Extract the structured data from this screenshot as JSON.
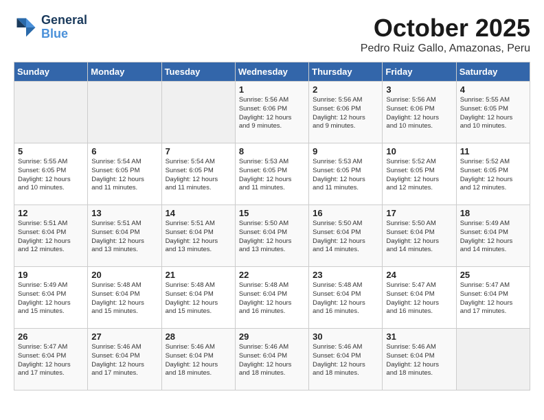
{
  "header": {
    "logo_line1": "General",
    "logo_line2": "Blue",
    "title": "October 2025",
    "subtitle": "Pedro Ruiz Gallo, Amazonas, Peru"
  },
  "days_of_week": [
    "Sunday",
    "Monday",
    "Tuesday",
    "Wednesday",
    "Thursday",
    "Friday",
    "Saturday"
  ],
  "weeks": [
    [
      {
        "day": "",
        "info": ""
      },
      {
        "day": "",
        "info": ""
      },
      {
        "day": "",
        "info": ""
      },
      {
        "day": "1",
        "info": "Sunrise: 5:56 AM\nSunset: 6:06 PM\nDaylight: 12 hours\nand 9 minutes."
      },
      {
        "day": "2",
        "info": "Sunrise: 5:56 AM\nSunset: 6:06 PM\nDaylight: 12 hours\nand 9 minutes."
      },
      {
        "day": "3",
        "info": "Sunrise: 5:56 AM\nSunset: 6:06 PM\nDaylight: 12 hours\nand 10 minutes."
      },
      {
        "day": "4",
        "info": "Sunrise: 5:55 AM\nSunset: 6:05 PM\nDaylight: 12 hours\nand 10 minutes."
      }
    ],
    [
      {
        "day": "5",
        "info": "Sunrise: 5:55 AM\nSunset: 6:05 PM\nDaylight: 12 hours\nand 10 minutes."
      },
      {
        "day": "6",
        "info": "Sunrise: 5:54 AM\nSunset: 6:05 PM\nDaylight: 12 hours\nand 11 minutes."
      },
      {
        "day": "7",
        "info": "Sunrise: 5:54 AM\nSunset: 6:05 PM\nDaylight: 12 hours\nand 11 minutes."
      },
      {
        "day": "8",
        "info": "Sunrise: 5:53 AM\nSunset: 6:05 PM\nDaylight: 12 hours\nand 11 minutes."
      },
      {
        "day": "9",
        "info": "Sunrise: 5:53 AM\nSunset: 6:05 PM\nDaylight: 12 hours\nand 11 minutes."
      },
      {
        "day": "10",
        "info": "Sunrise: 5:52 AM\nSunset: 6:05 PM\nDaylight: 12 hours\nand 12 minutes."
      },
      {
        "day": "11",
        "info": "Sunrise: 5:52 AM\nSunset: 6:05 PM\nDaylight: 12 hours\nand 12 minutes."
      }
    ],
    [
      {
        "day": "12",
        "info": "Sunrise: 5:51 AM\nSunset: 6:04 PM\nDaylight: 12 hours\nand 12 minutes."
      },
      {
        "day": "13",
        "info": "Sunrise: 5:51 AM\nSunset: 6:04 PM\nDaylight: 12 hours\nand 13 minutes."
      },
      {
        "day": "14",
        "info": "Sunrise: 5:51 AM\nSunset: 6:04 PM\nDaylight: 12 hours\nand 13 minutes."
      },
      {
        "day": "15",
        "info": "Sunrise: 5:50 AM\nSunset: 6:04 PM\nDaylight: 12 hours\nand 13 minutes."
      },
      {
        "day": "16",
        "info": "Sunrise: 5:50 AM\nSunset: 6:04 PM\nDaylight: 12 hours\nand 14 minutes."
      },
      {
        "day": "17",
        "info": "Sunrise: 5:50 AM\nSunset: 6:04 PM\nDaylight: 12 hours\nand 14 minutes."
      },
      {
        "day": "18",
        "info": "Sunrise: 5:49 AM\nSunset: 6:04 PM\nDaylight: 12 hours\nand 14 minutes."
      }
    ],
    [
      {
        "day": "19",
        "info": "Sunrise: 5:49 AM\nSunset: 6:04 PM\nDaylight: 12 hours\nand 15 minutes."
      },
      {
        "day": "20",
        "info": "Sunrise: 5:48 AM\nSunset: 6:04 PM\nDaylight: 12 hours\nand 15 minutes."
      },
      {
        "day": "21",
        "info": "Sunrise: 5:48 AM\nSunset: 6:04 PM\nDaylight: 12 hours\nand 15 minutes."
      },
      {
        "day": "22",
        "info": "Sunrise: 5:48 AM\nSunset: 6:04 PM\nDaylight: 12 hours\nand 16 minutes."
      },
      {
        "day": "23",
        "info": "Sunrise: 5:48 AM\nSunset: 6:04 PM\nDaylight: 12 hours\nand 16 minutes."
      },
      {
        "day": "24",
        "info": "Sunrise: 5:47 AM\nSunset: 6:04 PM\nDaylight: 12 hours\nand 16 minutes."
      },
      {
        "day": "25",
        "info": "Sunrise: 5:47 AM\nSunset: 6:04 PM\nDaylight: 12 hours\nand 17 minutes."
      }
    ],
    [
      {
        "day": "26",
        "info": "Sunrise: 5:47 AM\nSunset: 6:04 PM\nDaylight: 12 hours\nand 17 minutes."
      },
      {
        "day": "27",
        "info": "Sunrise: 5:46 AM\nSunset: 6:04 PM\nDaylight: 12 hours\nand 17 minutes."
      },
      {
        "day": "28",
        "info": "Sunrise: 5:46 AM\nSunset: 6:04 PM\nDaylight: 12 hours\nand 18 minutes."
      },
      {
        "day": "29",
        "info": "Sunrise: 5:46 AM\nSunset: 6:04 PM\nDaylight: 12 hours\nand 18 minutes."
      },
      {
        "day": "30",
        "info": "Sunrise: 5:46 AM\nSunset: 6:04 PM\nDaylight: 12 hours\nand 18 minutes."
      },
      {
        "day": "31",
        "info": "Sunrise: 5:46 AM\nSunset: 6:04 PM\nDaylight: 12 hours\nand 18 minutes."
      },
      {
        "day": "",
        "info": ""
      }
    ]
  ]
}
